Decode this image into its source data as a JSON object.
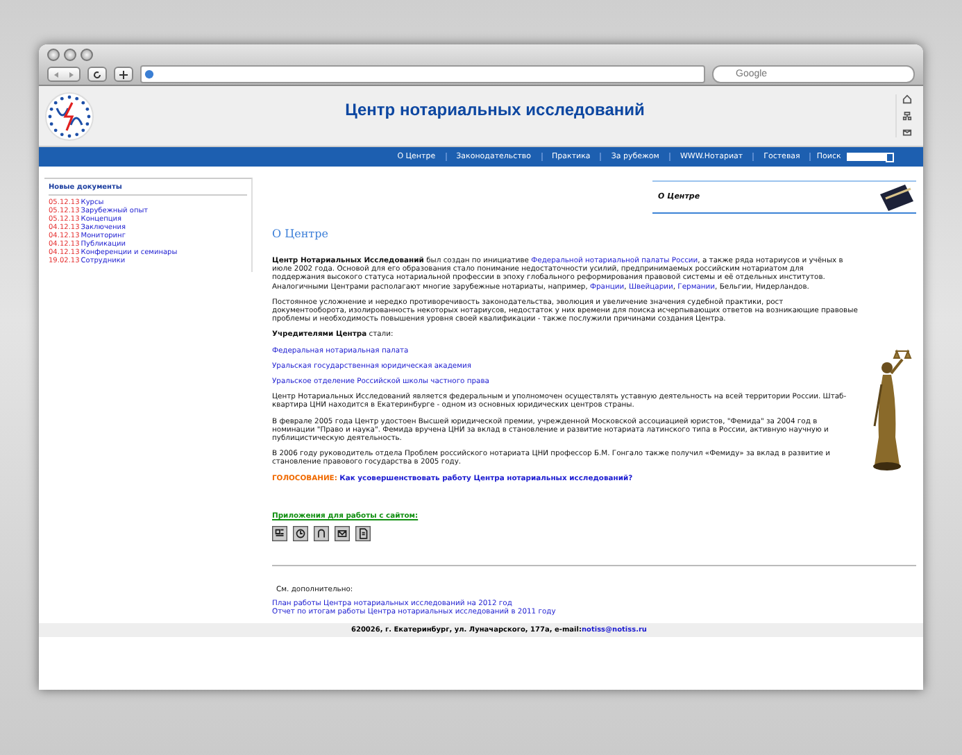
{
  "browser": {
    "search_placeholder": "Google"
  },
  "header": {
    "title": "Центр нотариальных исследований"
  },
  "nav": {
    "items": [
      {
        "label": "О Центре"
      },
      {
        "label": "Законодательство"
      },
      {
        "label": "Практика"
      },
      {
        "label": "За рубежом"
      },
      {
        "label": "WWW.Нотариат"
      },
      {
        "label": "Гостевая"
      }
    ],
    "search_label": "Поиск"
  },
  "sidebar": {
    "title": "Новые документы",
    "items": [
      {
        "date": "05.12.13",
        "title": "Курсы"
      },
      {
        "date": "05.12.13",
        "title": "Зарубежный опыт"
      },
      {
        "date": "05.12.13",
        "title": "Концепция"
      },
      {
        "date": "04.12.13",
        "title": "Заключения"
      },
      {
        "date": "04.12.13",
        "title": "Мониторинг"
      },
      {
        "date": "04.12.13",
        "title": "Публикации"
      },
      {
        "date": "04.12.13",
        "title": "Конференции и семинары"
      },
      {
        "date": "19.02.13",
        "title": "Сотрудники"
      }
    ]
  },
  "banner": {
    "title": "О Центре"
  },
  "page_title": "О Центре",
  "paragraphs": [
    [
      {
        "kind": "bold",
        "text": "Центр Нотариальных Исследований"
      },
      {
        "kind": "plain",
        "text": " был создан по инициативе "
      },
      {
        "kind": "link",
        "text": "Федеральной нотариальной палаты России"
      },
      {
        "kind": "plain",
        "text": ", а также ряда нотариусов и учёных в июле 2002 года. Основой для его образования стало понимание недостаточности усилий, предпринимаемых российским нотариатом для поддержания высокого статуса нотариальной профессии в эпоху глобального реформирования правовой системы и её отдельных институтов. Аналогичными Центрами располагают многие зарубежные нотариаты, например, "
      },
      {
        "kind": "link",
        "text": "Франции"
      },
      {
        "kind": "plain",
        "text": ", "
      },
      {
        "kind": "link",
        "text": "Швейцарии"
      },
      {
        "kind": "plain",
        "text": ", "
      },
      {
        "kind": "link",
        "text": "Германии"
      },
      {
        "kind": "plain",
        "text": ", Бельгии, Нидерландов."
      }
    ],
    [
      {
        "kind": "plain",
        "text": "Постоянное усложнение и нередко противоречивость законодательства, эволюция и увеличение значения судебной практики, рост документооборота, изолированность некоторых нотариусов, недостаток у них времени для поиска исчерпывающих ответов на возникающие правовые проблемы и необходимость повышения уровня своей квалификации - также послужили причинами создания Центра."
      }
    ],
    [
      {
        "kind": "bold",
        "text": "Учредителями Центра"
      },
      {
        "kind": "plain",
        "text": " стали:"
      }
    ]
  ],
  "founders": [
    "Федеральная нотариальная палата",
    "Уральская государственная юридическая академия",
    "Уральское отделение Российской школы частного права"
  ],
  "paragraphs_2": [
    [
      {
        "kind": "plain",
        "text": "Центр Нотариальных Исследований является федеральным и уполномочен осуществлять уставную деятельность на всей территории России. Штаб-квартира ЦНИ находится в Екатеринбурге - одном из основных юридических центров страны."
      }
    ],
    [
      {
        "kind": "plain",
        "text": "В феврале 2005 года Центр удостоен Высшей юридической премии, учрежденной Московской ассоциацией юристов, \"Фемида\" за 2004 год в номинации \"Право и наука\". Фемида вручена ЦНИ за вклад в становление и развитие нотариата латинского типа в России, активную научную и публицистическую деятельность."
      }
    ],
    [
      {
        "kind": "plain",
        "text": "В 2006 году руководитель отдела Проблем российского нотариата ЦНИ профессор Б.М. Гонгало также получил «Фемиду» за вклад в развитие и становление правового государства в 2005 году."
      }
    ]
  ],
  "poll": {
    "label": "ГОЛОСОВАНИЕ:",
    "question": "Как усовершенствовать работу Центра нотариальных исследований?"
  },
  "apps": {
    "title": "Приложения для работы с сайтом:"
  },
  "see_also": {
    "title": "См. дополнительно:",
    "links": [
      "План работы Центра нотариальных исследований на 2012 год",
      "Отчет по итогам работы Центра нотариальных исследований в 2011 году"
    ]
  },
  "footer": {
    "address": "620026, г. Екатеринбург, ул. Луначарского, 177а, e-mail: ",
    "email": "notiss@notiss.ru"
  }
}
